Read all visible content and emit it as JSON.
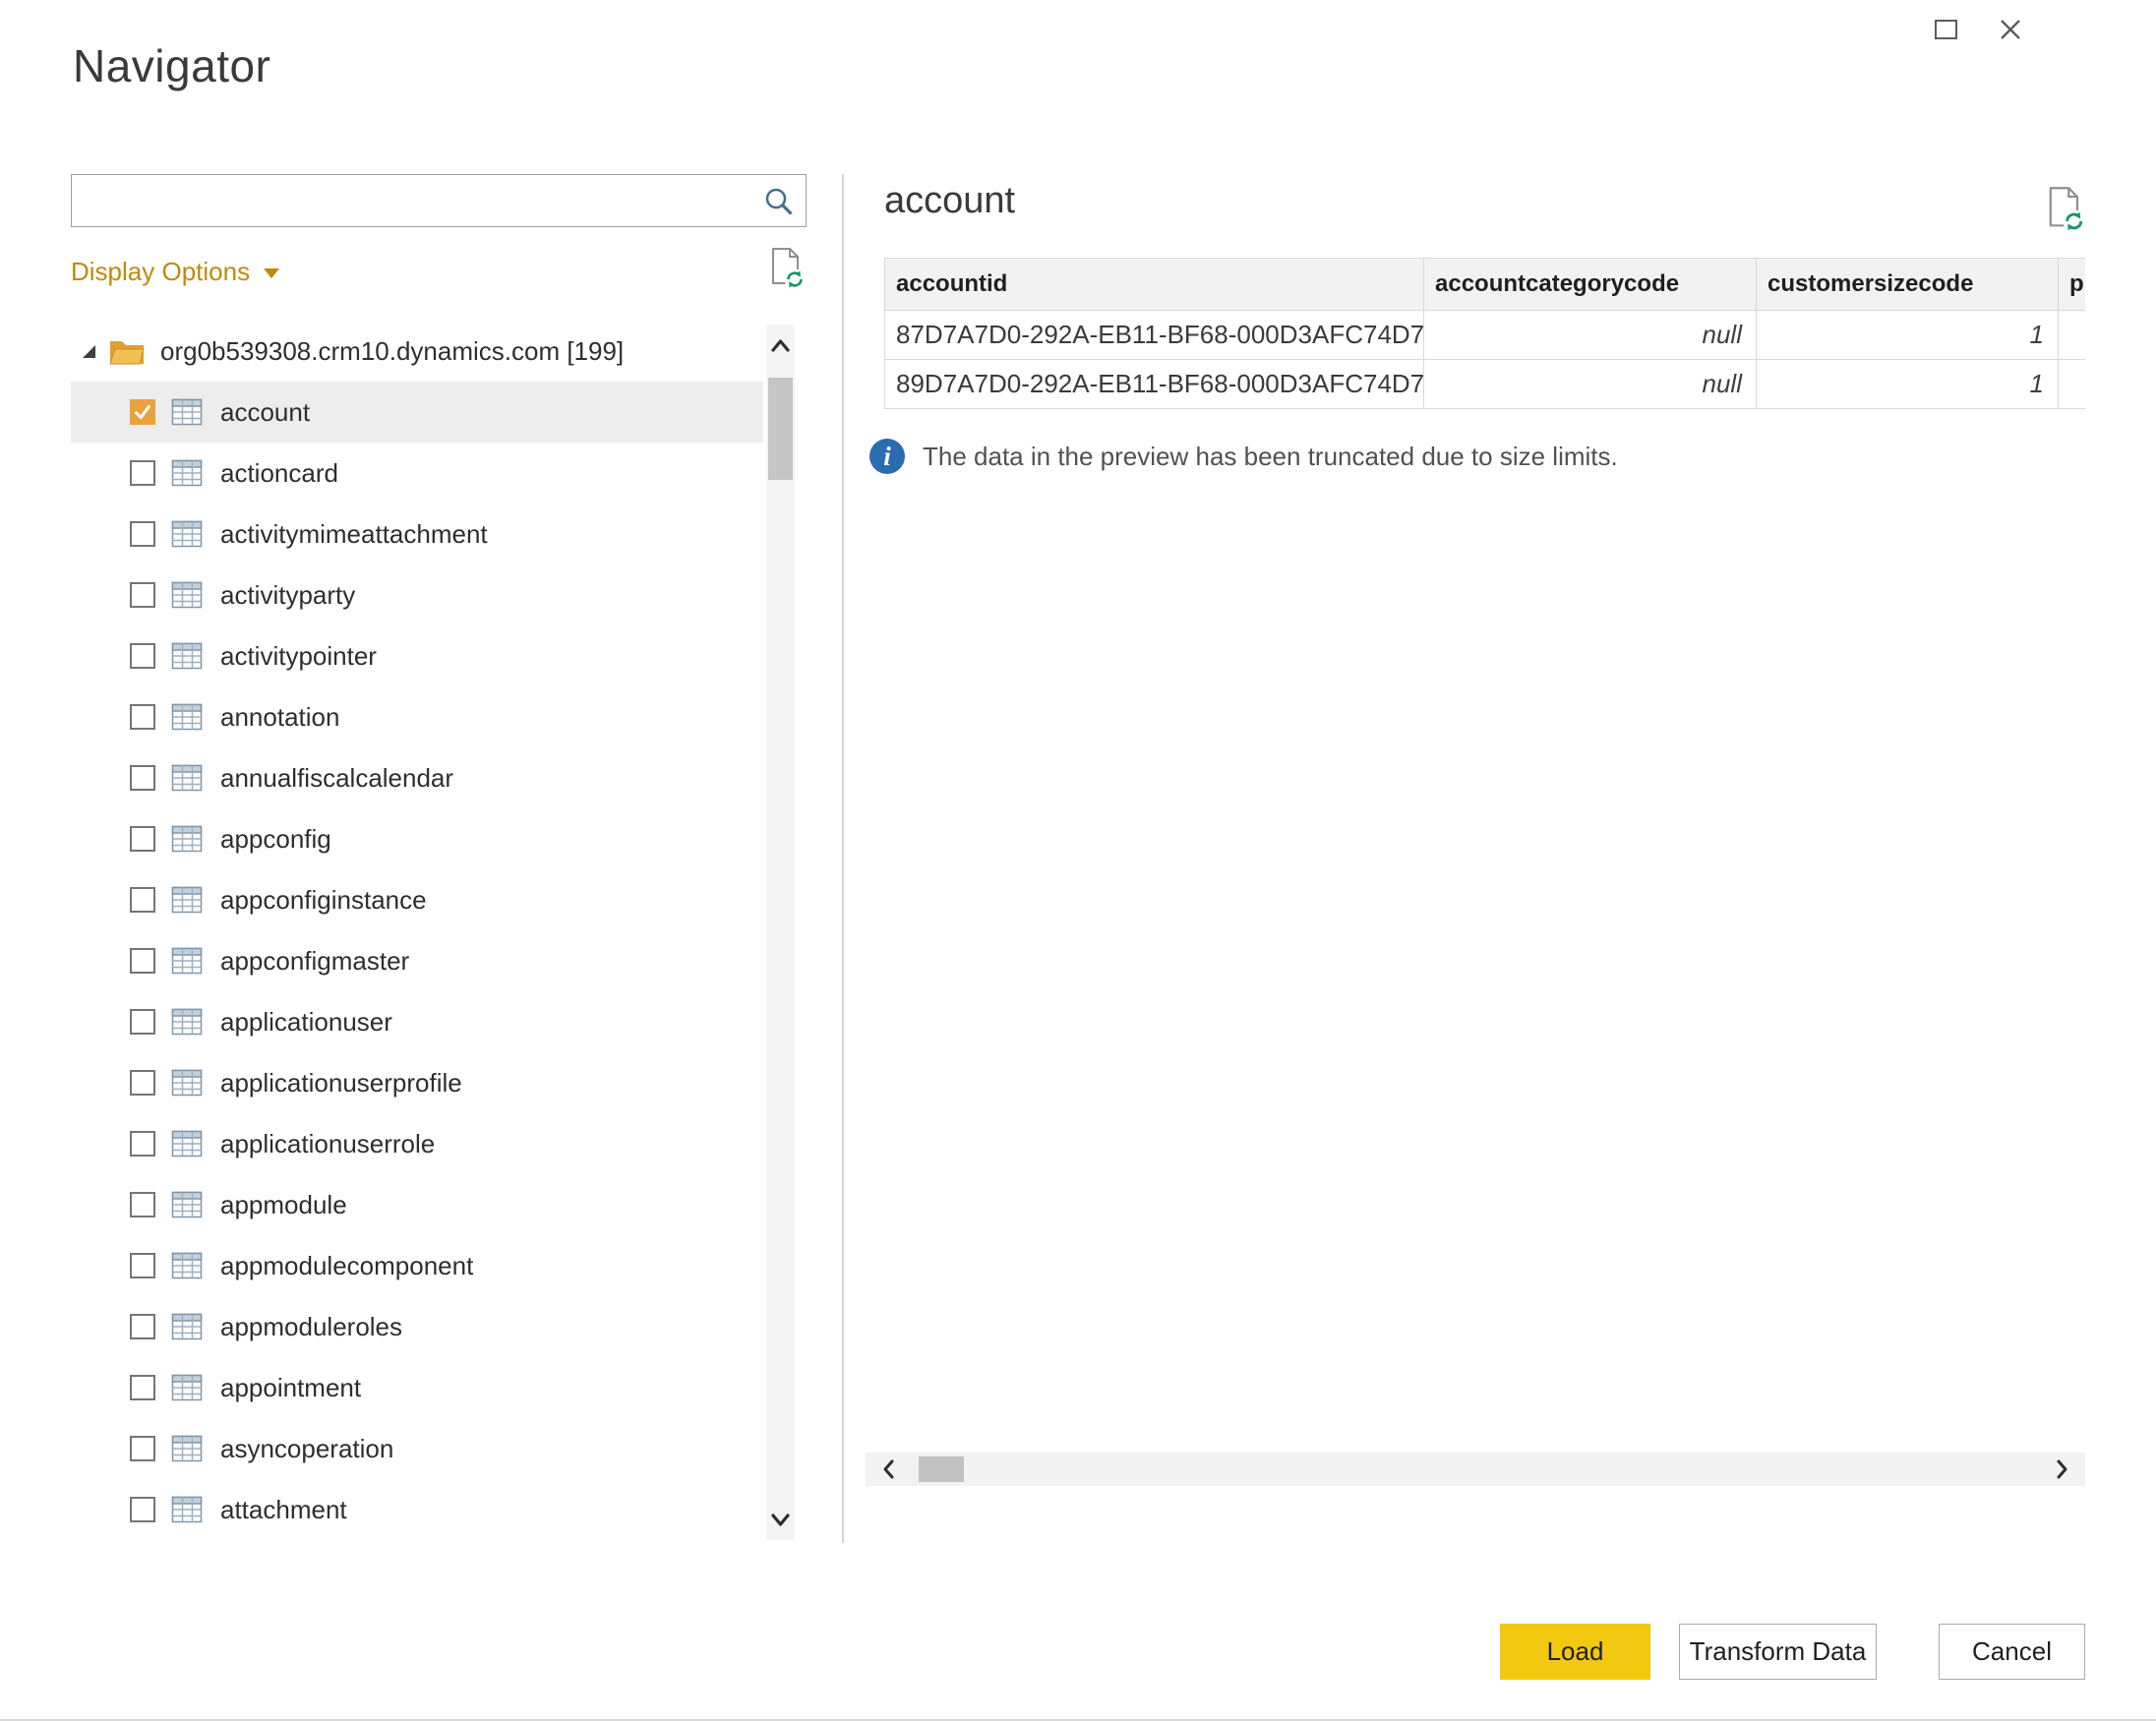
{
  "window": {
    "title": "Navigator"
  },
  "search": {
    "placeholder": "",
    "value": ""
  },
  "left_panel": {
    "display_options_label": "Display Options",
    "root": {
      "label": "org0b539308.crm10.dynamics.com [199]",
      "expanded": true
    },
    "items": [
      {
        "label": "account",
        "checked": true,
        "selected": true
      },
      {
        "label": "actioncard",
        "checked": false,
        "selected": false
      },
      {
        "label": "activitymimeattachment",
        "checked": false,
        "selected": false
      },
      {
        "label": "activityparty",
        "checked": false,
        "selected": false
      },
      {
        "label": "activitypointer",
        "checked": false,
        "selected": false
      },
      {
        "label": "annotation",
        "checked": false,
        "selected": false
      },
      {
        "label": "annualfiscalcalendar",
        "checked": false,
        "selected": false
      },
      {
        "label": "appconfig",
        "checked": false,
        "selected": false
      },
      {
        "label": "appconfiginstance",
        "checked": false,
        "selected": false
      },
      {
        "label": "appconfigmaster",
        "checked": false,
        "selected": false
      },
      {
        "label": "applicationuser",
        "checked": false,
        "selected": false
      },
      {
        "label": "applicationuserprofile",
        "checked": false,
        "selected": false
      },
      {
        "label": "applicationuserrole",
        "checked": false,
        "selected": false
      },
      {
        "label": "appmodule",
        "checked": false,
        "selected": false
      },
      {
        "label": "appmodulecomponent",
        "checked": false,
        "selected": false
      },
      {
        "label": "appmoduleroles",
        "checked": false,
        "selected": false
      },
      {
        "label": "appointment",
        "checked": false,
        "selected": false
      },
      {
        "label": "asyncoperation",
        "checked": false,
        "selected": false
      },
      {
        "label": "attachment",
        "checked": false,
        "selected": false
      }
    ]
  },
  "preview": {
    "title": "account",
    "columns": [
      "accountid",
      "accountcategorycode",
      "customersizecode",
      "pr"
    ],
    "rows": [
      [
        "87D7A7D0-292A-EB11-BF68-000D3AFC74D7",
        "null",
        "1",
        ""
      ],
      [
        "89D7A7D0-292A-EB11-BF68-000D3AFC74D7",
        "null",
        "1",
        ""
      ]
    ],
    "notice": "The data in the preview has been truncated due to size limits."
  },
  "footer": {
    "load_label": "Load",
    "transform_label": "Transform Data",
    "cancel_label": "Cancel"
  },
  "colors": {
    "accent": "#F2C811",
    "display_options": "#C08A0A",
    "checkbox_checked": "#E8A33D",
    "info_icon": "#2B6CB0",
    "refresh_green": "#1C9268",
    "search_icon": "#44708E"
  },
  "icons": {
    "search": "magnifier",
    "refresh_preview": "page-with-refresh-arrows",
    "folder": "open-folder",
    "table": "grid-table",
    "expand": "triangle-expanded",
    "info": "circle-i",
    "maximize": "square-outline",
    "close": "x",
    "scrollbar": "chevrons"
  }
}
